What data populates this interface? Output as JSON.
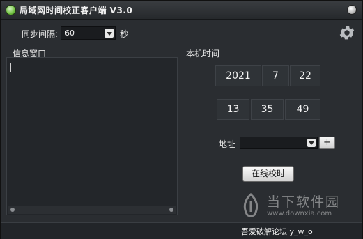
{
  "window": {
    "title": "局域网时间校正客户端 V3.0"
  },
  "sync_interval": {
    "label": "同步间隔:",
    "value": "60",
    "unit": "秒"
  },
  "info_panel": {
    "title": "信息窗口"
  },
  "local_time": {
    "title": "本机时间",
    "year": "2021",
    "month": "7",
    "day": "22",
    "hour": "13",
    "minute": "35",
    "second": "49"
  },
  "address": {
    "label": "地址",
    "value": "",
    "add_label": "+"
  },
  "sync_button": {
    "label": "在线校时"
  },
  "statusbar": {
    "text": "吾爱破解论坛  y_w_o"
  },
  "watermark": {
    "name": "当下软件园",
    "url": "www.downxia.com"
  },
  "icons": {
    "app": "app-logo-icon",
    "close": "close-icon",
    "settings": "gear-icon"
  }
}
